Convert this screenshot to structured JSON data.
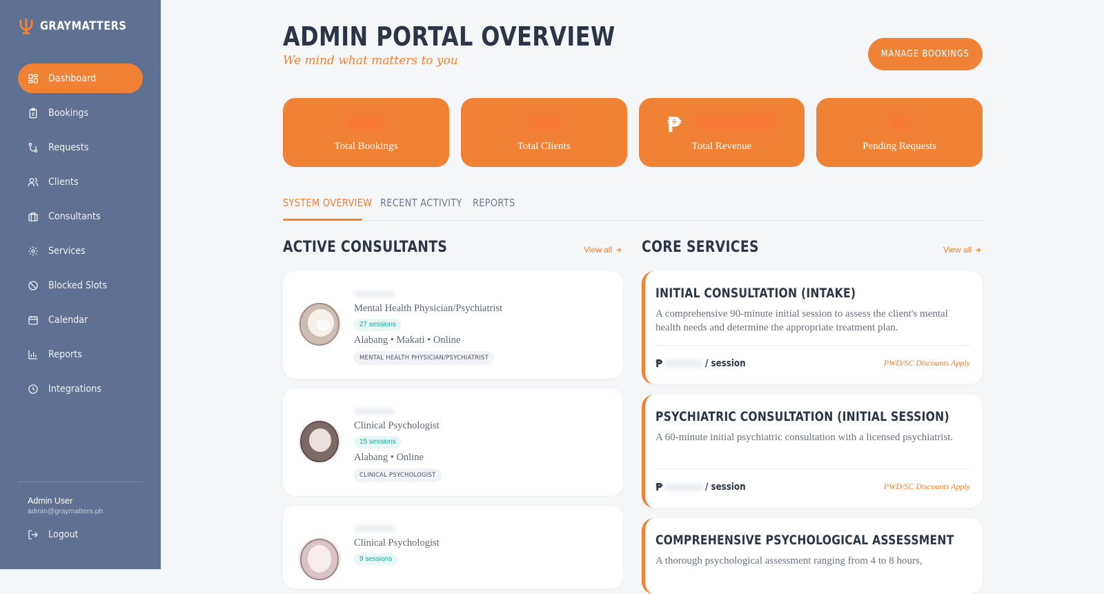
{
  "brand": {
    "name": "GRAYMATTERS",
    "icon": "psi-logo-icon"
  },
  "colors": {
    "accent": "#f08236",
    "sidebar": "#5f7193",
    "session_badge": "#1aa69a"
  },
  "sidebar": {
    "items": [
      {
        "label": "Dashboard",
        "icon": "dashboard-icon",
        "active": true
      },
      {
        "label": "Bookings",
        "icon": "clipboard-icon"
      },
      {
        "label": "Requests",
        "icon": "route-icon"
      },
      {
        "label": "Clients",
        "icon": "users-icon"
      },
      {
        "label": "Consultants",
        "icon": "briefcase-icon"
      },
      {
        "label": "Services",
        "icon": "gear-icon"
      },
      {
        "label": "Blocked Slots",
        "icon": "ban-icon"
      },
      {
        "label": "Calendar",
        "icon": "calendar-icon"
      },
      {
        "label": "Reports",
        "icon": "bar-chart-icon"
      },
      {
        "label": "Integrations",
        "icon": "clock-icon"
      }
    ],
    "user": {
      "name": "Admin User",
      "email": "admin@graymatters.ph"
    },
    "logout_label": "Logout"
  },
  "header": {
    "title": "ADMIN PORTAL OVERVIEW",
    "tagline": "We mind what matters to you",
    "manage_button": "MANAGE BOOKINGS"
  },
  "stats": [
    {
      "label": "Total Bookings"
    },
    {
      "label": "Total Clients"
    },
    {
      "label": "Total Revenue",
      "currency": "₱"
    },
    {
      "label": "Pending Requests"
    }
  ],
  "tabs": [
    {
      "label": "SYSTEM OVERVIEW",
      "active": true
    },
    {
      "label": "RECENT ACTIVITY"
    },
    {
      "label": "REPORTS"
    }
  ],
  "consultants_section": {
    "title": "ACTIVE CONSULTANTS",
    "view_all": "View all",
    "items": [
      {
        "role": "Mental Health Physician/Psychiatrist",
        "sessions": "27 sessions",
        "location": "Alabang • Makati • Online",
        "tag": "MENTAL HEALTH PHYSICIAN/PSYCHIATRIST"
      },
      {
        "role": "Clinical Psychologist",
        "sessions": "15 sessions",
        "location": "Alabang • Online",
        "tag": "CLINICAL PSYCHOLOGIST"
      },
      {
        "role": "Clinical Psychologist",
        "sessions": "9 sessions"
      }
    ]
  },
  "services_section": {
    "title": "CORE SERVICES",
    "view_all": "View all",
    "items": [
      {
        "title": "INITIAL CONSULTATION (INTAKE)",
        "description": "A comprehensive 90-minute initial session to assess the client's mental health needs and determine the appropriate treatment plan.",
        "currency": "₱",
        "per": "/ session",
        "discount": "PWD/SC Discounts Apply"
      },
      {
        "title": "PSYCHIATRIC CONSULTATION (INITIAL SESSION)",
        "description": "A 60-minute initial psychiatric consultation with a licensed psychiatrist.",
        "currency": "₱",
        "per": "/ session",
        "discount": "PWD/SC Discounts Apply"
      },
      {
        "title": "COMPREHENSIVE PSYCHOLOGICAL ASSESSMENT",
        "description": "A thorough psychological assessment ranging from 4 to 8 hours,"
      }
    ]
  }
}
